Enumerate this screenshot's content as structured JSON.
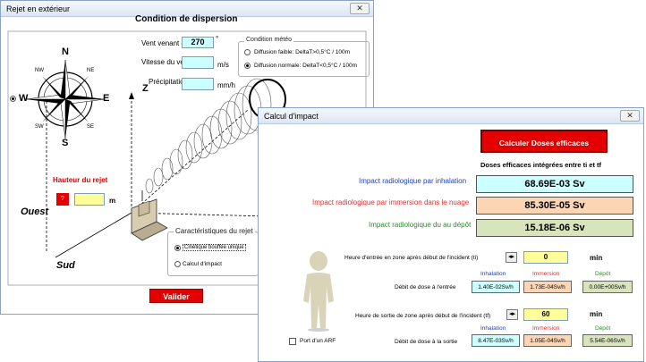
{
  "window1": {
    "title": "Rejet en extérieur",
    "heading": "Condition de dispersion",
    "compass": {
      "N": "N",
      "S": "S",
      "E": "E",
      "W": "W",
      "NE": "NE",
      "NW": "NW",
      "SE": "SE",
      "SW": "SW"
    },
    "wind_direction": {
      "label": "Vent venant du",
      "value": "270",
      "unit": "°"
    },
    "wind_speed": {
      "label": "Vitesse du vent",
      "value": "",
      "unit": "m/s"
    },
    "precipitation": {
      "label": "Précipitation",
      "value": "",
      "unit": "mm/h"
    },
    "meteo": {
      "title": "Condition météo",
      "option1": "Diffusion faible: DeltaT>0,5°C / 100m",
      "option2": "Diffusion normale: DeltaT<0,5°C / 100m"
    },
    "height": {
      "label": "Hauteur du rejet",
      "badge": "?",
      "value": "",
      "unit": "m"
    },
    "axis_z": "Z",
    "ouest": "Ouest",
    "sud": "Sud",
    "release": {
      "title": "Caractéristiques du rejet",
      "option1": "Cinétique bouffée unique",
      "option2": "Calcul d'impact"
    },
    "validate_label": "Valider"
  },
  "window2": {
    "title": "Calcul d'impact",
    "calc_button": "Calculer Doses efficaces intégrées",
    "doses_title": "Doses efficaces intégrées entre ti et tf",
    "inhalation": {
      "label": "Impact radiologique par inhalation",
      "value": "68.69E-03 Sv",
      "color": "#ccffff",
      "label_color": "#1f3fbf"
    },
    "immersion": {
      "label": "Impact radiologique par immersion dans le nuage",
      "value": "85.30E-05 Sv",
      "color": "#fcd5b4",
      "label_color": "#e03030"
    },
    "depot": {
      "label": "Impact radiologique du au dépôt",
      "value": "15.18E-06 Sv",
      "color": "#d8e4bc",
      "label_color": "#2e8b2e"
    },
    "entry": {
      "label": "Heure d'entrée en zone après début de l'incident (ti)",
      "value": "0",
      "unit": "min",
      "rate_label": "Débit de dose à l'entrée",
      "col_inhalation": "Inhalation",
      "col_immersion": "Immersion",
      "col_depot": "Dépôt",
      "inhalation": "1.40E-02Sv/h",
      "immersion": "1.73E-04Sv/h",
      "depot": "0.00E+00Sv/h"
    },
    "exit": {
      "label": "Heure de sortie de zone après début de l'incident (tf)",
      "value": "60",
      "unit": "min",
      "rate_label": "Débit de dose à la sortie",
      "col_inhalation": "Inhalation",
      "col_immersion": "Immersion",
      "col_depot": "Dépôt",
      "inhalation": "8.47E-03Sv/h",
      "immersion": "1.05E-04Sv/h",
      "depot": "5.54E-06Sv/h"
    },
    "arf_label": "Port d'un ARF"
  },
  "colors": {
    "red_button": "#e40000",
    "yellow_field": "#ffff99",
    "cyan_field": "#ccffff"
  }
}
